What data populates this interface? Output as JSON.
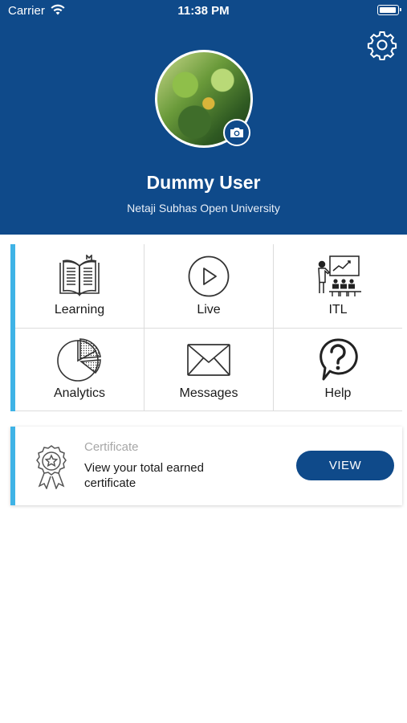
{
  "status_bar": {
    "carrier": "Carrier",
    "time": "11:38 PM",
    "wifi_icon": "wifi-icon",
    "battery_icon": "battery-icon"
  },
  "header": {
    "background_color": "#0f4a8a",
    "settings_icon": "gear-icon",
    "camera_icon": "camera-icon",
    "user_name": "Dummy User",
    "organization": "Netaji Subhas Open University"
  },
  "menu": {
    "accent_color": "#3fb3e6",
    "items": [
      {
        "label": "Learning",
        "icon": "book-icon"
      },
      {
        "label": "Live",
        "icon": "play-icon"
      },
      {
        "label": "ITL",
        "icon": "presentation-icon"
      },
      {
        "label": "Analytics",
        "icon": "pie-chart-icon"
      },
      {
        "label": "Messages",
        "icon": "envelope-icon"
      },
      {
        "label": "Help",
        "icon": "help-bubble-icon"
      }
    ]
  },
  "certificate": {
    "icon": "award-badge-icon",
    "title": "Certificate",
    "description": "View your total earned certificate",
    "button_label": "VIEW"
  }
}
